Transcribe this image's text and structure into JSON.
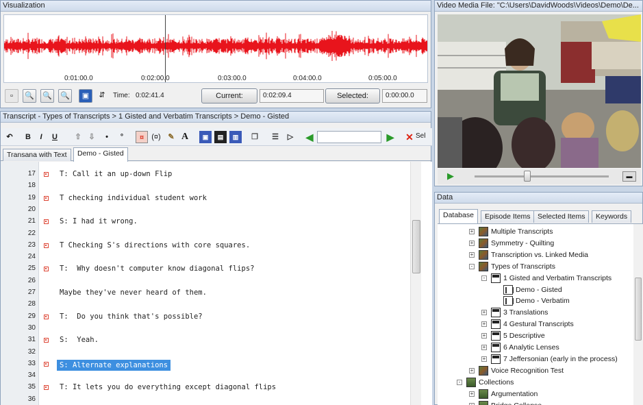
{
  "visualization": {
    "title": "Visualization",
    "ticks": [
      "0:01:00.0",
      "0:02:00.0",
      "0:03:00.0",
      "0:04:00.0",
      "0:05:00.0"
    ],
    "time_label": "Time:",
    "time_value": "0:02:41.4",
    "current_label": "Current:",
    "current_value": "0:02:09.4",
    "selected_label": "Selected:",
    "selected_value": "0:00:00.0",
    "waveform_color": "#e8141c"
  },
  "video": {
    "title": "Video Media File:  \"C:\\Users\\DavidWoods\\Videos\\Demo\\De..."
  },
  "transcript": {
    "breadcrumb": "Transcript - Types of Transcripts > 1 Gisted and Verbatim Transcripts > Demo - Gisted",
    "tabs": [
      "Transana with Text",
      "Demo - Gisted"
    ],
    "toolbar_tail": "Sel",
    "lines": [
      {
        "n": "17",
        "mark": true,
        "text": "T: Call it an up-down Flip"
      },
      {
        "n": "18",
        "mark": false,
        "text": ""
      },
      {
        "n": "19",
        "mark": true,
        "text": "T checking individual student work"
      },
      {
        "n": "20",
        "mark": false,
        "text": ""
      },
      {
        "n": "21",
        "mark": true,
        "text": "S: I had it wrong."
      },
      {
        "n": "22",
        "mark": false,
        "text": ""
      },
      {
        "n": "23",
        "mark": true,
        "text": "T Checking S's directions with core squares."
      },
      {
        "n": "24",
        "mark": false,
        "text": ""
      },
      {
        "n": "25",
        "mark": true,
        "text": "T:  Why doesn't computer know diagonal flips?"
      },
      {
        "n": "26",
        "mark": false,
        "text": ""
      },
      {
        "n": "27",
        "mark": false,
        "text": "Maybe they've never heard of them."
      },
      {
        "n": "28",
        "mark": false,
        "text": ""
      },
      {
        "n": "29",
        "mark": true,
        "text": "T:  Do you think that's possible?"
      },
      {
        "n": "30",
        "mark": false,
        "text": ""
      },
      {
        "n": "31",
        "mark": true,
        "text": "S:  Yeah."
      },
      {
        "n": "32",
        "mark": false,
        "text": ""
      },
      {
        "n": "33",
        "mark": true,
        "text": "S: Alternate explanations",
        "selected": true
      },
      {
        "n": "34",
        "mark": false,
        "text": ""
      },
      {
        "n": "35",
        "mark": true,
        "text": "T: It lets you do everything except diagonal flips"
      },
      {
        "n": "36",
        "mark": false,
        "text": ""
      }
    ]
  },
  "data": {
    "title": "Data",
    "tabs": [
      "Database",
      "Episode Items",
      "Selected Items",
      "Keywords"
    ],
    "tree": [
      {
        "label": "Multiple Transcripts",
        "icon": "series",
        "level": 1,
        "expander": "+"
      },
      {
        "label": "Symmetry - Quilting",
        "icon": "series",
        "level": 1,
        "expander": "+"
      },
      {
        "label": "Transcription vs. Linked Media",
        "icon": "series",
        "level": 1,
        "expander": "+"
      },
      {
        "label": "Types of Transcripts",
        "icon": "series",
        "level": 1,
        "expander": "-"
      },
      {
        "label": "1 Gisted and Verbatim Transcripts",
        "icon": "episode",
        "level": 2,
        "expander": "-"
      },
      {
        "label": "Demo - Gisted",
        "icon": "tdoc",
        "level": 3,
        "expander": ""
      },
      {
        "label": "Demo - Verbatim",
        "icon": "tdoc",
        "level": 3,
        "expander": ""
      },
      {
        "label": "3 Translations",
        "icon": "episode",
        "level": 2,
        "expander": "+"
      },
      {
        "label": "4 Gestural Transcripts",
        "icon": "episode",
        "level": 2,
        "expander": "+"
      },
      {
        "label": "5 Descriptive",
        "icon": "episode",
        "level": 2,
        "expander": "+"
      },
      {
        "label": "6 Analytic Lenses",
        "icon": "episode",
        "level": 2,
        "expander": "+"
      },
      {
        "label": "7 Jeffersonian (early in the process)",
        "icon": "episode",
        "level": 2,
        "expander": "+"
      },
      {
        "label": "Voice Recognition Test",
        "icon": "series",
        "level": 1,
        "expander": "+"
      },
      {
        "label": "Collections",
        "icon": "coll",
        "level": 0,
        "expander": "-"
      },
      {
        "label": "Argumentation",
        "icon": "coll",
        "level": 1,
        "expander": "+"
      },
      {
        "label": "Bridge Collapse",
        "icon": "coll",
        "level": 1,
        "expander": "+"
      }
    ]
  }
}
